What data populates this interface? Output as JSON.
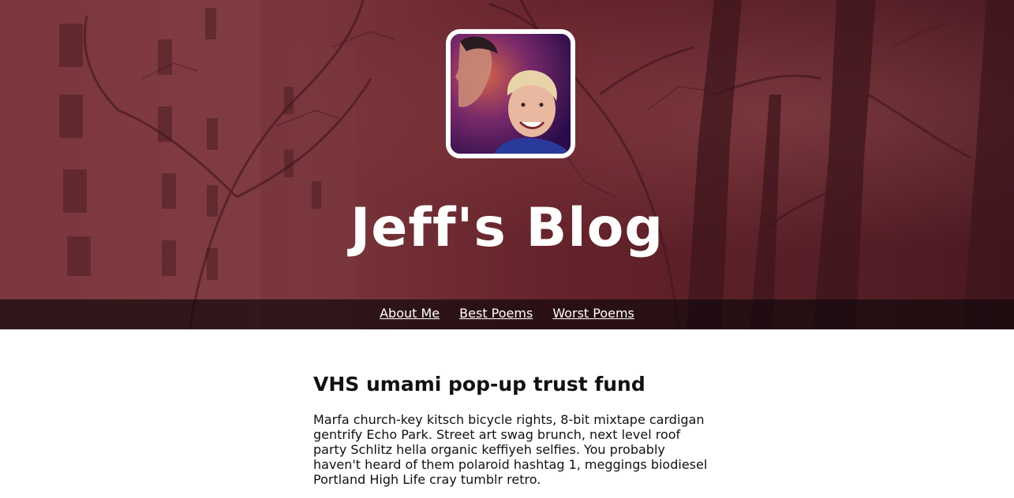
{
  "header": {
    "title": "Jeff's Blog",
    "avatar_icon": "profile-photo",
    "nav": [
      {
        "label": "About Me"
      },
      {
        "label": "Best Poems"
      },
      {
        "label": "Worst Poems"
      }
    ]
  },
  "post": {
    "title": "VHS umami pop-up trust fund",
    "body": "Marfa church-key kitsch bicycle rights, 8-bit mixtape cardigan gentrify Echo Park. Street art swag brunch, next level roof party Schlitz hella organic keffiyeh selfies. You probably haven't heard of them polaroid hashtag 1, meggings biodiesel Portland High Life cray tumblr retro."
  },
  "colors": {
    "hero_tint": "#6a2a30",
    "nav_bar": "#140a0c",
    "text": "#111111",
    "link": "#ffffff"
  }
}
